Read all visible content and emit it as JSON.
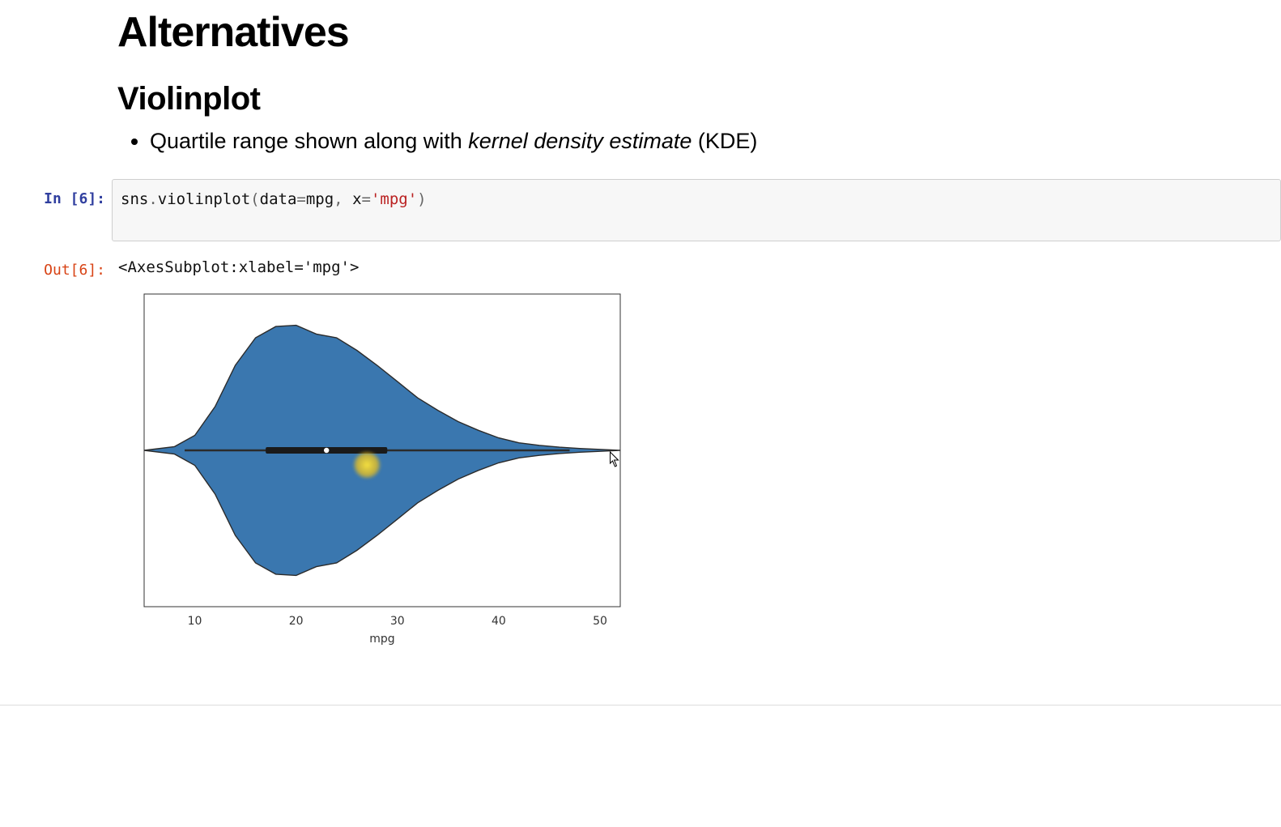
{
  "markdown": {
    "heading": "Alternatives",
    "subheading": "Violinplot",
    "bullet_prefix": "Quartile range shown along with ",
    "bullet_em": "kernel density estimate",
    "bullet_suffix": " (KDE)"
  },
  "cell": {
    "in_prompt": "In [6]:",
    "out_prompt": "Out[6]:",
    "code_src": "sns.violinplot(data=mpg, x='mpg')",
    "code_tokens": {
      "t0": "sns",
      "t1": ".",
      "t2": "violinplot",
      "t3": "(",
      "t4": "data",
      "t5": "=",
      "t6": "mpg",
      "t7": ", ",
      "t8": "x",
      "t9": "=",
      "t10": "'mpg'",
      "t11": ")"
    },
    "out_text": "<AxesSubplot:xlabel='mpg'>"
  },
  "chart_data": {
    "type": "violin",
    "variable": "mpg",
    "xlabel": "mpg",
    "ylabel": "",
    "title": "",
    "x_ticks": [
      10,
      20,
      30,
      40,
      50
    ],
    "x_range": [
      5,
      52
    ],
    "quartiles": {
      "q1": 17,
      "median": 23,
      "q3": 29
    },
    "whisker_range": [
      9,
      47
    ],
    "kde_profile": [
      {
        "x": 5,
        "h": 0.0
      },
      {
        "x": 8,
        "h": 0.03
      },
      {
        "x": 10,
        "h": 0.12
      },
      {
        "x": 12,
        "h": 0.35
      },
      {
        "x": 14,
        "h": 0.68
      },
      {
        "x": 16,
        "h": 0.9
      },
      {
        "x": 18,
        "h": 0.99
      },
      {
        "x": 20,
        "h": 1.0
      },
      {
        "x": 22,
        "h": 0.93
      },
      {
        "x": 24,
        "h": 0.9
      },
      {
        "x": 26,
        "h": 0.8
      },
      {
        "x": 28,
        "h": 0.68
      },
      {
        "x": 30,
        "h": 0.55
      },
      {
        "x": 32,
        "h": 0.42
      },
      {
        "x": 34,
        "h": 0.32
      },
      {
        "x": 36,
        "h": 0.23
      },
      {
        "x": 38,
        "h": 0.16
      },
      {
        "x": 40,
        "h": 0.1
      },
      {
        "x": 42,
        "h": 0.06
      },
      {
        "x": 44,
        "h": 0.04
      },
      {
        "x": 46,
        "h": 0.025
      },
      {
        "x": 48,
        "h": 0.015
      },
      {
        "x": 50,
        "h": 0.008
      },
      {
        "x": 52,
        "h": 0.0
      }
    ],
    "fill_color": "#3a77af",
    "highlight_marker_x": 27
  }
}
